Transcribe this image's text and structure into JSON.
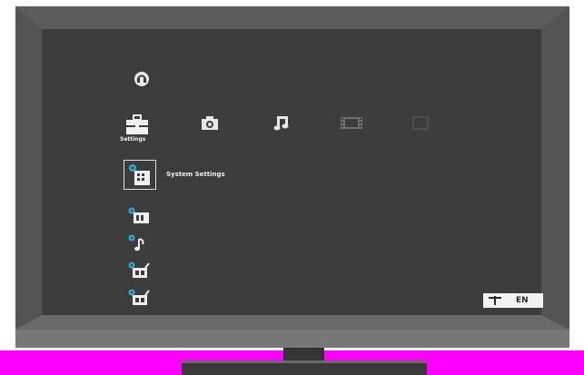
{
  "menu": {
    "active_category_label": "Settings",
    "categories": [
      {
        "icon": "toolbox-icon"
      },
      {
        "icon": "camera-icon"
      },
      {
        "icon": "music-note-icon"
      },
      {
        "icon": "film-icon"
      },
      {
        "icon": "tv-icon"
      }
    ],
    "selected_item_label": "System Settings",
    "items": [
      {
        "icon": "system-settings-icon"
      },
      {
        "icon": "display-settings-icon"
      },
      {
        "icon": "sound-settings-icon"
      },
      {
        "icon": "network-settings-icon"
      },
      {
        "icon": "network-settings-icon"
      }
    ]
  },
  "top_icon": "headset-icon",
  "language_badge": {
    "text": "EN"
  },
  "colors": {
    "screen": "#3c3c3c",
    "bezel": "#4a4a4a",
    "accent": "#31a9d6",
    "base": "#ff00ff"
  }
}
